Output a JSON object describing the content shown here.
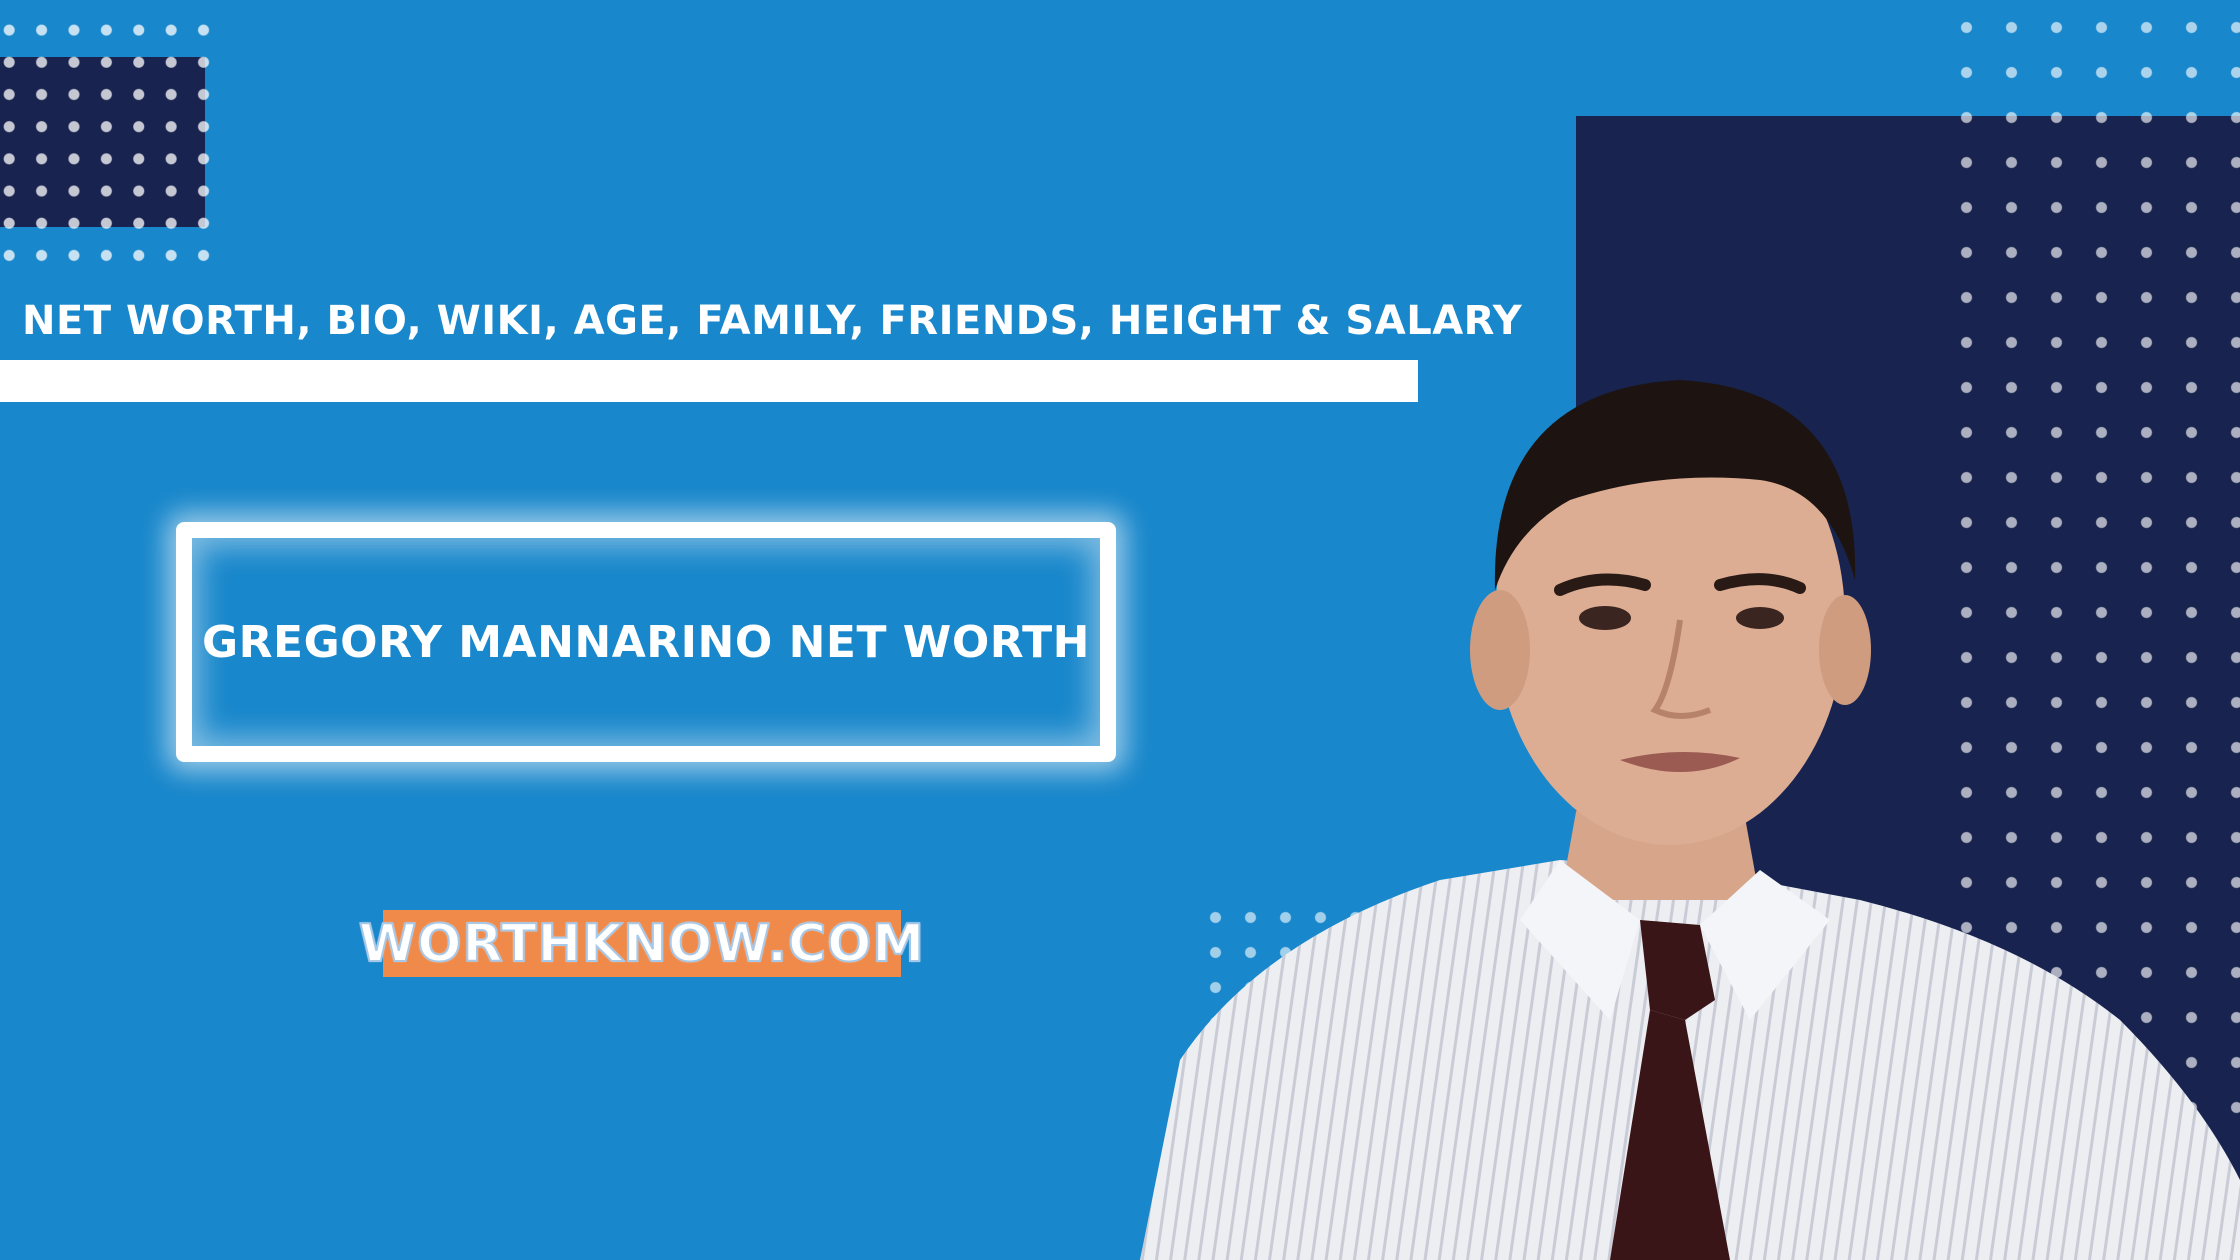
{
  "subtitle": "NET WORTH, BIO, WIKI, AGE, FAMILY, FRIENDS, HEIGHT & SALARY",
  "headline": "GREGORY MANNARINO NET WORTH",
  "site_badge": "WORTHKNOW.COM",
  "colors": {
    "background": "#1887cb",
    "navy": "#18244f",
    "white": "#ffffff",
    "badge": "#ef8a4a"
  }
}
